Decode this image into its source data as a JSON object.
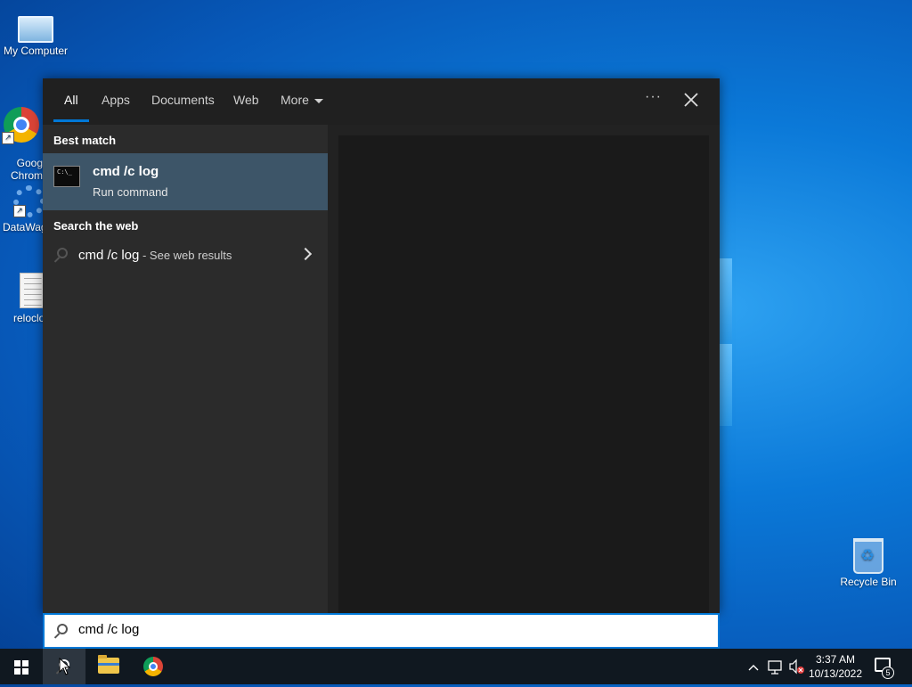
{
  "desktop": {
    "icons": [
      {
        "label": "My Computer",
        "icon": "computer-icon"
      },
      {
        "label": "Goog\nChrom",
        "icon": "chrome-icon"
      },
      {
        "label": "DataWag",
        "icon": "gear-icon"
      },
      {
        "label": "reloclo",
        "icon": "document-icon"
      },
      {
        "label": "Recycle Bin",
        "icon": "recycle-bin-icon"
      }
    ]
  },
  "search_panel": {
    "tabs": [
      {
        "label": "All",
        "active": true
      },
      {
        "label": "Apps"
      },
      {
        "label": "Documents"
      },
      {
        "label": "Web"
      },
      {
        "label": "More"
      }
    ],
    "options_icon": "ellipsis-icon",
    "close_icon": "close-icon",
    "best_match_heading": "Best match",
    "best_match": {
      "title": "cmd /c log",
      "subtitle": "Run command",
      "icon": "command-prompt-icon",
      "icon_text": "C:\\_"
    },
    "search_web_heading": "Search the web",
    "web_result": {
      "query": "cmd /c log",
      "suffix": " - See web results"
    }
  },
  "search_box": {
    "value": "cmd /c log",
    "icon": "search-icon"
  },
  "taskbar": {
    "buttons": [
      "start-button",
      "search-button",
      "file-explorer-button",
      "chrome-button"
    ],
    "tray_icons": [
      "chevron-up-icon",
      "network-icon",
      "volume-muted-icon"
    ],
    "time": "3:37 AM",
    "date": "10/13/2022",
    "notification_count": "5"
  },
  "colors": {
    "accent": "#0078d7",
    "selected_row": "#3d5568",
    "panel_bg": "#2b2b2b",
    "taskbar_bg": "#101820"
  }
}
